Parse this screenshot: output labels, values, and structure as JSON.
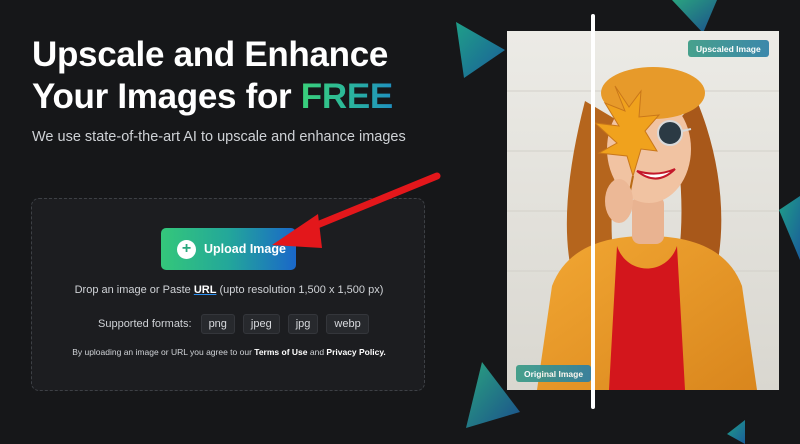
{
  "hero": {
    "title_line1": "Upscale and Enhance",
    "title_line2_prefix": "Your Images for ",
    "title_highlight": "FREE",
    "subtitle": "We use state-of-the-art AI to upscale and enhance images"
  },
  "upload": {
    "button_label": "Upload Image",
    "button_icon": "plus-icon",
    "hint_prefix": "Drop an image or Paste ",
    "hint_link": "URL",
    "hint_suffix": " (upto resolution 1,500 x 1,500 px)"
  },
  "formats": {
    "label": "Supported formats:",
    "items": [
      "png",
      "jpeg",
      "jpg",
      "webp"
    ]
  },
  "terms": {
    "prefix": "By uploading an image or URL you agree to our ",
    "terms_link": "Terms of Use",
    "middle": " and ",
    "privacy_link": "Privacy Policy."
  },
  "comparison": {
    "upscaled_label": "Upscaled Image",
    "original_label": "Original Image"
  },
  "colors": {
    "background": "#161719",
    "accent_green": "#34c77a",
    "accent_blue": "#1a67c9",
    "arrow_red": "#e3171b"
  }
}
